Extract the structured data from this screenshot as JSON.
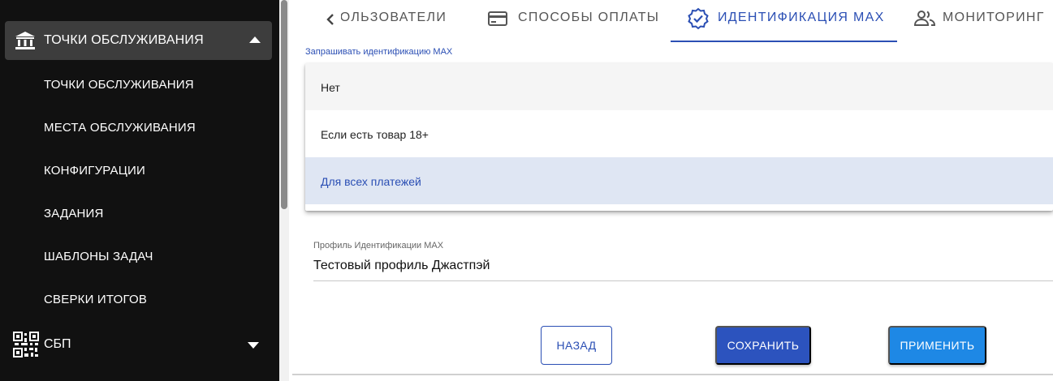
{
  "sidebar": {
    "group_label": "ТОЧКИ ОБСЛУЖИВАНИЯ",
    "items": [
      {
        "label": "ТОЧКИ ОБСЛУЖИВАНИЯ"
      },
      {
        "label": "МЕСТА ОБСЛУЖИВАНИЯ"
      },
      {
        "label": "КОНФИГУРАЦИИ"
      },
      {
        "label": "ЗАДАНИЯ"
      },
      {
        "label": "ШАБЛОНЫ ЗАДАЧ"
      },
      {
        "label": "СВЕРКИ ИТОГОВ"
      }
    ],
    "sbp_label": "СБП",
    "icons": {
      "group": "bank-icon",
      "sbp": "qr-code-icon"
    }
  },
  "tabs": [
    {
      "label": "ПОЛЬЗОВАТЕЛИ",
      "icon": "users-icon"
    },
    {
      "label": "СПОСОБЫ ОПЛАТЫ",
      "icon": "credit-card-icon"
    },
    {
      "label": "ИДЕНТИФИКАЦИЯ MAX",
      "icon": "verified-badge-icon",
      "active": true
    },
    {
      "label": "МОНИТОРИНГ",
      "icon": "people-icon"
    }
  ],
  "identification_select": {
    "label": "Запрашивать идентификацию MAX",
    "options": [
      {
        "label": "Нет"
      },
      {
        "label": "Если есть товар 18+"
      },
      {
        "label": "Для всех платежей",
        "selected": true
      }
    ]
  },
  "profile": {
    "label": "Профиль Идентификации MAX",
    "value": "Тестовый профиль Джастпэй"
  },
  "buttons": {
    "back": "НАЗАД",
    "save": "СОХРАНИТЬ",
    "apply": "ПРИМЕНИТЬ"
  },
  "colors": {
    "sidebar_bg": "#111111",
    "accent": "#2b4fb4",
    "apply": "#1e88e5",
    "selected_option_bg": "#dfe6f3"
  }
}
